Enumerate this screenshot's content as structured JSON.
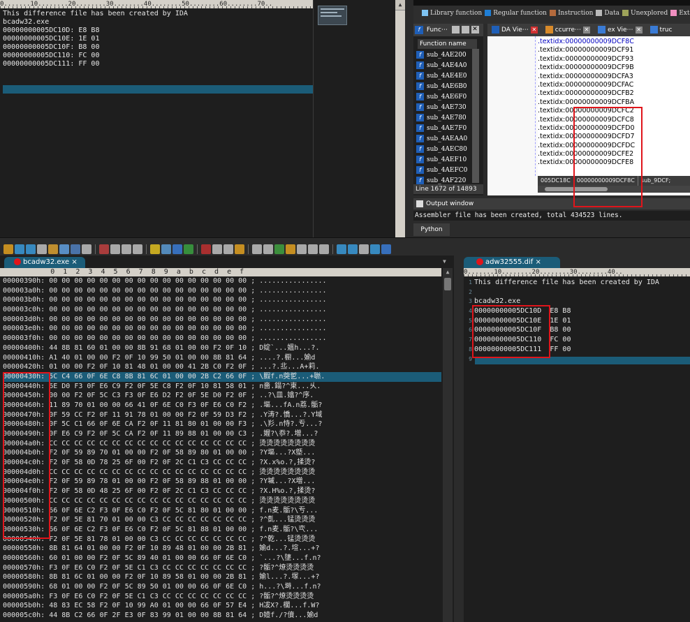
{
  "top_left_editor": {
    "ruler": "0.......10........20........30........40........50........60........70..",
    "lines": [
      "This difference file has been created by IDA",
      "",
      "bcadw32.exe",
      "00000000005DC10D: E8 B8",
      "00000000005DC10E: 1E 01",
      "00000000005DC10F: B8 00",
      "00000000005DC110: FC 00",
      "00000000005DC111: FF 00"
    ]
  },
  "ida": {
    "legend": [
      {
        "label": "Library function",
        "color": "#7ec3f1"
      },
      {
        "label": "Regular function",
        "color": "#1f7ed6"
      },
      {
        "label": "Instruction",
        "color": "#b46a3c"
      },
      {
        "label": "Data",
        "color": "#b9b9b9"
      },
      {
        "label": "Unexplored",
        "color": "#9ea35a"
      },
      {
        "label": "External",
        "color": "#f08fc0"
      }
    ],
    "functions_tab": "Func⋯",
    "views": [
      {
        "label": "DA Vie⋯"
      },
      {
        "label": "ccurre⋯"
      },
      {
        "label": "ex Vie⋯"
      },
      {
        "label": "truc"
      }
    ],
    "function_header": "Function name",
    "functions": [
      "sub_4AE200",
      "sub_4AE4A0",
      "sub_4AE4E0",
      "sub_4AE6B0",
      "sub_4AE6F0",
      "sub_4AE730",
      "sub_4AE780",
      "sub_4AE7F0",
      "sub_4AEAA0",
      "sub_4AEC80",
      "sub_4AEF10",
      "sub_4AEFC0",
      "sub_4AF220"
    ],
    "line_status": "Line 1672 of 14893",
    "disasm": [
      ".textidx:00000000009DCF8C",
      ".textidx:00000000009DCF91",
      ".textidx:00000000009DCF93",
      ".textidx:00000000009DCF9B",
      ".textidx:00000000009DCFA3",
      ".textidx:00000000009DCFAC",
      ".textidx:00000000009DCFB2",
      ".textidx:00000000009DCFBA",
      ".textidx:00000000009DCFC2",
      ".textidx:00000000009DCFC8",
      ".textidx:00000000009DCFD0",
      ".textidx:00000000009DCFD7",
      ".textidx:00000000009DCFDC",
      ".textidx:00000000009DCFE2",
      ".textidx:00000000009DCFE8"
    ],
    "disasm_status": [
      "005DC18C",
      "00000000009DCF8C",
      "sub_9DCF;"
    ],
    "output_title": "Output window",
    "output_text": "Assembler file has been created, total 434523 lines.",
    "python_tab": "Python"
  },
  "hex_tab": {
    "title": "bcadw32.exe",
    "close": "×"
  },
  "dif_tab": {
    "title": "adw32555.dif",
    "close": "×"
  },
  "hex_header": "            0  1  2  3  4  5  6  7  8  9  a  b  c  d  e  f",
  "hex_rows": [
    "00000390h: 00 00 00 00 00 00 00 00 00 00 00 00 00 00 00 00 ; ................",
    "000003a0h: 00 00 00 00 00 00 00 00 00 00 00 00 00 00 00 00 ; ................",
    "000003b0h: 00 00 00 00 00 00 00 00 00 00 00 00 00 00 00 00 ; ................",
    "000003c0h: 00 00 00 00 00 00 00 00 00 00 00 00 00 00 00 00 ; ................",
    "000003d0h: 00 00 00 00 00 00 00 00 00 00 00 00 00 00 00 00 ; ................",
    "000003e0h: 00 00 00 00 00 00 00 00 00 00 00 00 00 00 00 00 ; ................",
    "000003f0h: 00 00 00 00 00 00 00 00 00 00 00 00 00 00 00 00 ; ................",
    "00000400h: 44 8B 81 60 01 00 00 8B 91 68 01 00 00 F2 0F 10 ; D婝`...媼h...?.",
    "00000410h: A1 40 01 00 00 F2 0F 10 99 50 01 00 00 8B 81 64 ; ....?.櫉...媮d",
    "00000420h: 01 00 00 F2 0F 10 81 48 01 00 00 41 2B C0 F2 0F ; ...?.丠...A+莉.",
    "00000430h: 5C C4 66 0F 6E C8 8B 81 6C 01 00 00 2B C2 66 0F ; \\腵f.n葖乴...+聮.",
    "00000440h: 6E D0 F3 0F E6 C9 F2 0F 5E C8 F2 0F 10 81 58 01 ; n嗇.鎉?^柬...乆.",
    "00000450h: 00 00 F2 0F 5C C3 F3 0F E6 D2 F2 0F 5E D0 F2 0F ; ..?\\皿.嬆?^序.",
    "00000460h: 11 89 70 01 00 00 66 41 0F 6E C0 F3 0F E6 C0 F2 ; .塸...fA.n荔.骺?",
    "00000470h: 0F 59 CC F2 0F 11 91 78 01 00 00 F2 0F 59 D3 F2 ; .Y涛?.憍...?.Y域",
    "00000480h: 0F 5C C1 66 0F 6E CA F2 0F 11 81 80 01 00 00 F3 ; .\\羏.n恃?.亐...?",
    "00000490h: 0F E6 C9 F2 0F 5C CA F2 0F 11 89 88 01 00 00 C3 ; .媉?\\忝?.増...?",
    "000004a0h: CC CC CC CC CC CC CC CC CC CC CC CC CC CC CC CC ; 烫烫烫烫烫烫烫烫",
    "000004b0h: F2 0F 59 89 70 01 00 00 F2 0F 58 89 80 01 00 00 ; ?Y塸...?X墍...",
    "000004c0h: F2 0F 58 0D 78 25 6F 00 F2 0F 2C C1 C3 CC CC CC ; ?X.x%o.?,揉烫?",
    "000004d0h: CC CC CC CC CC CC CC CC CC CC CC CC CC CC CC CC ; 烫烫烫烫烫烫烫烫",
    "000004e0h: F2 0F 59 89 78 01 00 00 F2 0F 58 89 88 01 00 00 ; ?Y墄...?X増...",
    "000004f0h: F2 0F 58 0D 48 25 6F 00 F2 0F 2C C1 C3 CC CC CC ; ?X.H%o.?,揉烫?",
    "00000500h: CC CC CC CC CC CC CC CC CC CC CC CC CC CC CC CC ; 烫烫烫烫烫烫烫烫",
    "00000510h: 66 0F 6E C2 F3 0F E6 C0 F2 0F 5C 81 80 01 00 00 ; f.n麦.骺?\\亐...",
    "00000520h: F2 0F 5E 81 70 01 00 00 C3 CC CC CC CC CC CC CC ; ?^亄...锰烫烫烫",
    "00000530h: 66 0F 6E C2 F3 0F E6 C0 F2 0F 5C 81 88 01 00 00 ; f.n麦.骺?\\亪...",
    "00000540h: F2 0F 5E 81 78 01 00 00 C3 CC CC CC CC CC CC CC ; ?^亁...锰烫烫烫",
    "00000550h: 8B 81 64 01 00 00 F2 0F 10 89 48 01 00 00 2B 81 ; 媮d...?.塇...+?",
    "00000560h: 60 01 00 00 F2 0F 5C 89 40 01 00 00 66 0F 6E C0 ; `...?\\塦...f.n?",
    "00000570h: F3 0F E6 C0 F2 0F 5E C1 C3 CC CC CC CC CC CC CC ; ?骺?^燎烫烫烫烫",
    "00000580h: 8B 81 6C 01 00 00 F2 0F 10 89 58 01 00 00 2B 81 ; 媮l...?.塜...+?",
    "00000590h: 68 01 00 00 F2 0F 5C 89 50 01 00 00 66 0F 6E C0 ; h...?\\塒...f.n?",
    "000005a0h: F3 0F E6 C0 F2 0F 5E C1 C3 CC CC CC CC CC CC CC ; ?骺?^燎烫烫烫烫",
    "000005b0h: 48 83 EC 58 F2 0F 10 99 A0 01 00 00 66 0F 57 E4 ; H冹X?.櫊...f.W?",
    "000005c0h: 44 8B C2 66 0F 2F E3 0F 83 99 01 00 00 8B 81 64 ; D嬄f./?儥...媮d"
  ],
  "dif_ruler": "0.......10........20........30........40..",
  "dif_lines": [
    {
      "n": "1",
      "text": "This difference file has been created by IDA"
    },
    {
      "n": "2",
      "text": ""
    },
    {
      "n": "3",
      "text": "bcadw32.exe"
    },
    {
      "n": "4",
      "text": "00000000005DC10D  E8 B8"
    },
    {
      "n": "5",
      "text": "00000000005DC10E  1E 01"
    },
    {
      "n": "6",
      "text": "00000000005DC10F  B8 00"
    },
    {
      "n": "7",
      "text": "00000000005DC110  FC 00"
    },
    {
      "n": "8",
      "text": "00000000005DC111  FF 00"
    },
    {
      "n": "9",
      "text": ""
    }
  ]
}
